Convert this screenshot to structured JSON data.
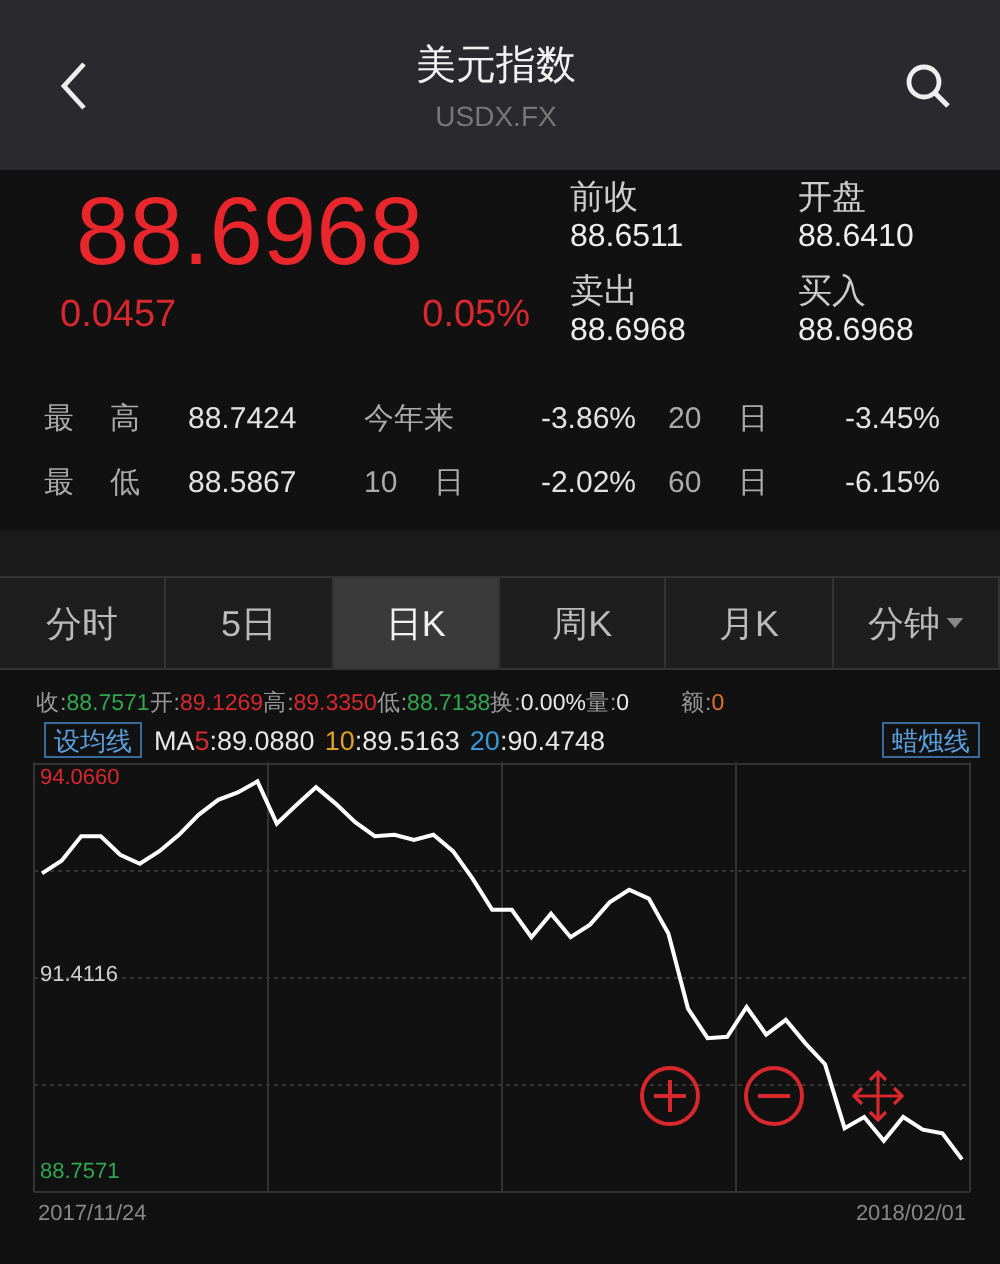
{
  "header": {
    "title": "美元指数",
    "subtitle": "USDX.FX"
  },
  "quote": {
    "price": "88.6968",
    "change": "0.0457",
    "change_pct": "0.05%",
    "fields": [
      {
        "label": "前收",
        "value": "88.6511"
      },
      {
        "label": "开盘",
        "value": "88.6410"
      },
      {
        "label": "卖出",
        "value": "88.6968"
      },
      {
        "label": "买入",
        "value": "88.6968"
      }
    ]
  },
  "stats": [
    [
      {
        "label": "最 高",
        "value": "88.7424"
      },
      {
        "label": "今年来",
        "value": "-3.86%"
      },
      {
        "label": "20 日",
        "value": "-3.45%"
      }
    ],
    [
      {
        "label": "最 低",
        "value": "88.5867"
      },
      {
        "label": "10 日",
        "value": "-2.02%"
      },
      {
        "label": "60 日",
        "value": "-6.15%"
      }
    ]
  ],
  "tabs": [
    {
      "label": "分时",
      "selected": false,
      "dropdown": false
    },
    {
      "label": "5日",
      "selected": false,
      "dropdown": false
    },
    {
      "label": "日K",
      "selected": true,
      "dropdown": false
    },
    {
      "label": "周K",
      "selected": false,
      "dropdown": false
    },
    {
      "label": "月K",
      "selected": false,
      "dropdown": false
    },
    {
      "label": "分钟",
      "selected": false,
      "dropdown": true
    }
  ],
  "ohlc": [
    {
      "label": "收:",
      "value": "88.7571",
      "color": "#2fa84f"
    },
    {
      "label": "开:",
      "value": "89.1269",
      "color": "#d8282e"
    },
    {
      "label": "高:",
      "value": "89.3350",
      "color": "#d8282e"
    },
    {
      "label": "低:",
      "value": "88.7138",
      "color": "#2fa84f"
    },
    {
      "label": "换:",
      "value": "0.00%",
      "color": "#e8e8e8"
    },
    {
      "label": "量:",
      "value": "0",
      "color": "#e8e8e8"
    },
    {
      "label": "额:",
      "value": "0",
      "color": "#e07030"
    }
  ],
  "ma_button": "设均线",
  "candle_button": "蜡烛线",
  "ma": [
    {
      "prefix": "MA",
      "key": "5",
      "value": ":89.0880",
      "color": "#d8282e"
    },
    {
      "key": "10",
      "value": ":89.5163",
      "color": "#e0a020"
    },
    {
      "key": "20",
      "value": ":90.4748",
      "color": "#3a9ad8"
    }
  ],
  "chart": {
    "chart_data": {
      "type": "line",
      "ylim": [
        88.49,
        94.28
      ],
      "yticks": [
        {
          "value": 94.066,
          "label": "94.0660"
        },
        {
          "value": 91.4116,
          "label": "91.4116"
        },
        {
          "value": 88.7571,
          "label": "88.7571"
        }
      ],
      "series": [
        {
          "color": "#ffffff",
          "values": [
            92.78,
            92.95,
            93.28,
            93.28,
            93.03,
            92.91,
            93.08,
            93.3,
            93.57,
            93.77,
            93.87,
            94.02,
            93.45,
            93.7,
            93.94,
            93.72,
            93.47,
            93.28,
            93.3,
            93.23,
            93.3,
            93.08,
            92.71,
            92.29,
            92.29,
            91.92,
            92.24,
            91.92,
            92.09,
            92.39,
            92.56,
            92.44,
            91.97,
            90.96,
            90.56,
            90.58,
            90.98,
            90.61,
            90.81,
            90.49,
            90.21,
            89.35,
            89.5,
            89.18,
            89.5,
            89.33,
            89.28,
            88.93
          ]
        }
      ]
    },
    "date_start": "2017/11/24",
    "date_end": "2018/02/01"
  }
}
